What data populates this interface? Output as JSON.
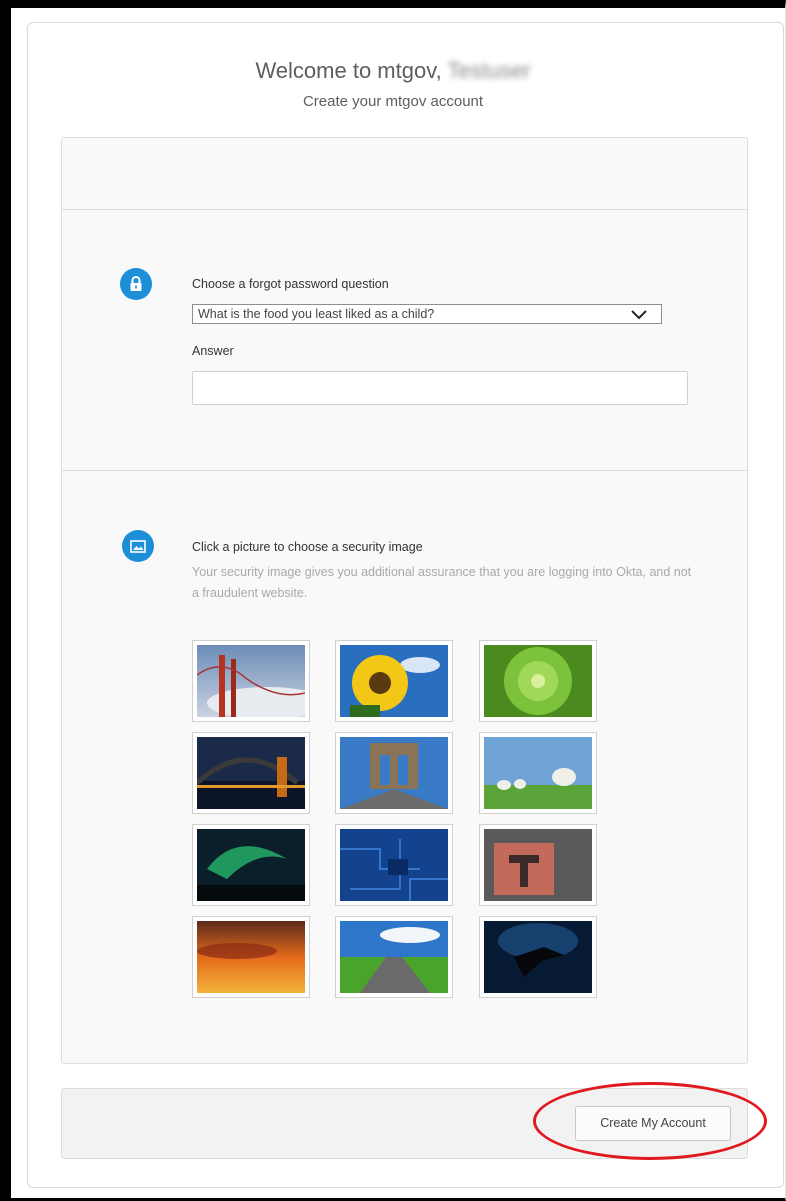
{
  "header": {
    "welcome_prefix": "Welcome to mtgov,",
    "welcome_name_obscured": "Testuser",
    "subtitle": "Create your mtgov account"
  },
  "forgot_password": {
    "icon": "lock-icon",
    "label": "Choose a forgot password question",
    "selected_question": "What is the food you least liked as a child?",
    "answer_label": "Answer",
    "answer_value": ""
  },
  "security_image": {
    "icon": "image-icon",
    "title": "Click a picture to choose a security image",
    "help": "Your security image gives you additional assurance that you are logging into Okta, and not a fraudulent website.",
    "images": [
      "golden-gate-bridge",
      "sunflower",
      "succulent",
      "harbour-bridge",
      "brooklyn-bridge",
      "sheep",
      "aurora",
      "circuit-board",
      "red-block",
      "sunset-clouds",
      "road",
      "manta-ray"
    ]
  },
  "footer": {
    "submit_label": "Create My Account"
  },
  "colors": {
    "accent": "#1c8fd6",
    "highlight": "#e0191e"
  }
}
